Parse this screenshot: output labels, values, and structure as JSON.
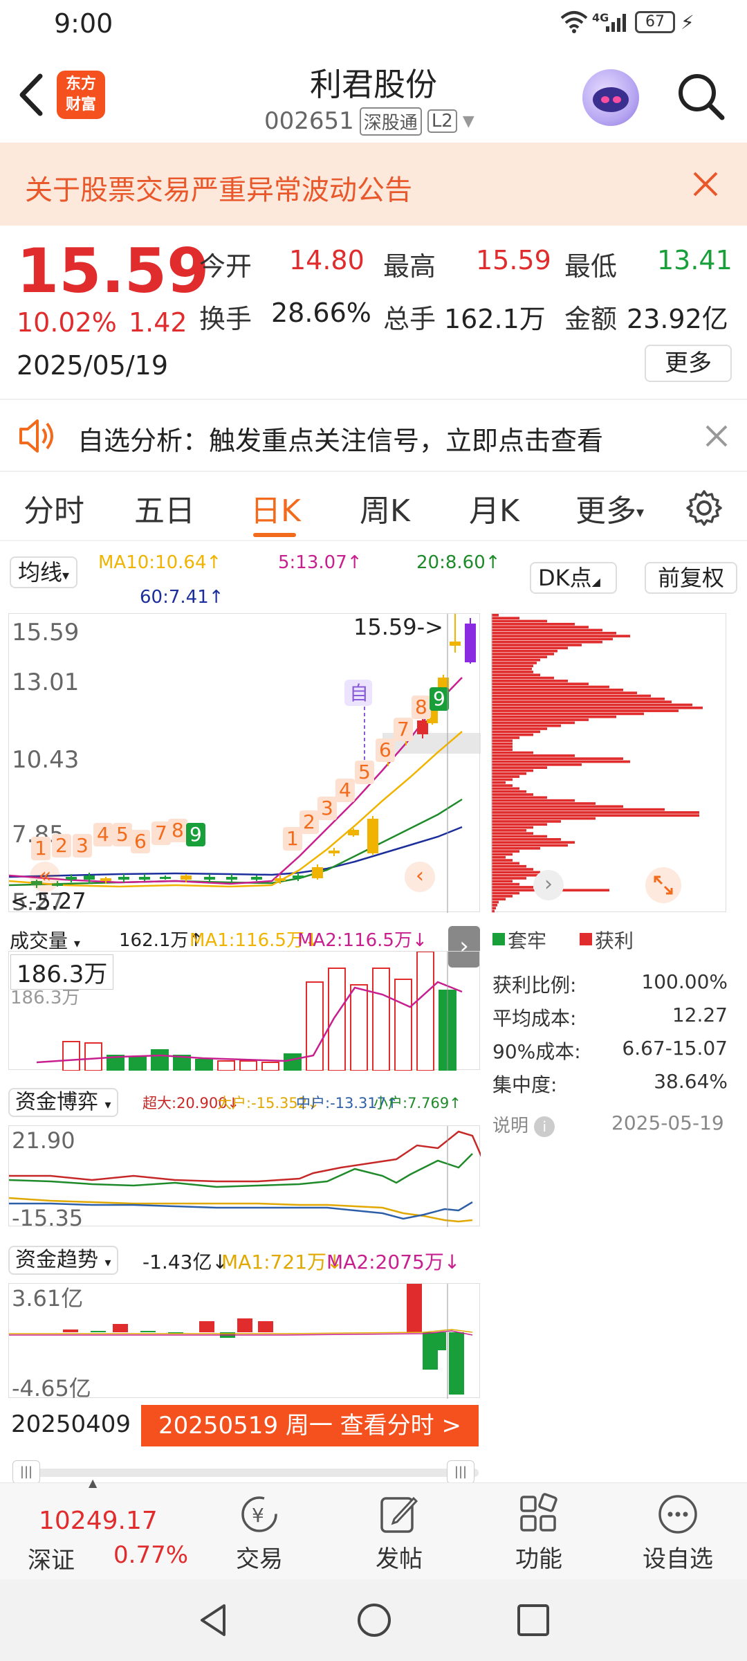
{
  "status": {
    "time": "9:00",
    "network": "4G",
    "battery": "67"
  },
  "header": {
    "title": "利君股份",
    "code": "002651",
    "badge_sgt": "深股通",
    "badge_l2": "L2",
    "logo_line1": "东方",
    "logo_line2": "财富"
  },
  "notice": {
    "text": "关于股票交易严重异常波动公告"
  },
  "quote": {
    "price": "15.59",
    "change_pct": "10.02%",
    "change": "1.42",
    "date": "2025/05/19",
    "open_label": "今开",
    "open": "14.80",
    "high_label": "最高",
    "high": "15.59",
    "low_label": "最低",
    "low": "13.41",
    "turnover_label": "换手",
    "turnover": "28.66%",
    "volume_label": "总手",
    "volume": "162.1万",
    "amount_label": "金额",
    "amount": "23.92亿",
    "more": "更多"
  },
  "analysis": {
    "text": "自选分析：触发重点关注信号，立即点击查看"
  },
  "tabs": [
    "分时",
    "五日",
    "日K",
    "周K",
    "月K",
    "更多"
  ],
  "kline": {
    "ma_select": "均线",
    "ma10": "MA10:10.64↑",
    "ma5": "5:13.07↑",
    "ma20": "20:8.60↑",
    "ma60": "60:7.41↑",
    "dk_button": "DK点",
    "adjust_button": "前复权",
    "y_labels": [
      "15.59",
      "13.01",
      "10.43",
      "7.85",
      "5.27"
    ],
    "high_marker": "15.59->",
    "low_marker": "<-5.27",
    "self_tag": "自",
    "nine_labels": [
      "1",
      "2",
      "3",
      "4",
      "5",
      "6",
      "7",
      "8",
      "9",
      "1",
      "2",
      "3",
      "4",
      "5",
      "6",
      "7",
      "8",
      "9"
    ]
  },
  "volume": {
    "select": "成交量",
    "value": "162.1万↑",
    "ma1": "MA1:116.5万↓",
    "ma2": "MA2:116.5万↓",
    "tip": "186.3万",
    "top": "186.3万"
  },
  "fund_game": {
    "select": "资金博弈",
    "super": "超大:20.900↓",
    "large": "大户:-15.352↓",
    "mid": "中户:-13.317↑",
    "small": "小户:7.769↑",
    "y_top": "21.90",
    "y_bottom": "-15.35"
  },
  "fund_trend": {
    "select": "资金趋势",
    "value": "-1.43亿↓",
    "ma1": "MA1:721万↓",
    "ma2": "MA2:2075万↓",
    "y_top": "3.61亿",
    "y_bottom": "-4.65亿"
  },
  "timeline": {
    "start": "20250409",
    "action": "20250519 周一 查看分时 >"
  },
  "chips": {
    "legend_trapped": "套牢",
    "legend_profit": "获利",
    "rows": [
      {
        "label": "获利比例:",
        "value": "100.00%"
      },
      {
        "label": "平均成本:",
        "value": "12.27"
      },
      {
        "label": "90%成本:",
        "value": "6.67-15.07"
      },
      {
        "label": "集中度:",
        "value": "38.64%"
      }
    ],
    "note": "说明",
    "date": "2025-05-19"
  },
  "bottomnav": {
    "index_value": "10249.17",
    "index_name": "深证",
    "index_pct": "0.77%",
    "items": [
      "交易",
      "发帖",
      "功能",
      "设自选"
    ]
  },
  "colors": {
    "up": "#e02c2c",
    "down": "#199f3a",
    "accent": "#f26b1d",
    "ma5": "#c81f8f",
    "ma10": "#f0b400",
    "ma20": "#1e8a2a",
    "ma60": "#1b2e9c"
  }
}
